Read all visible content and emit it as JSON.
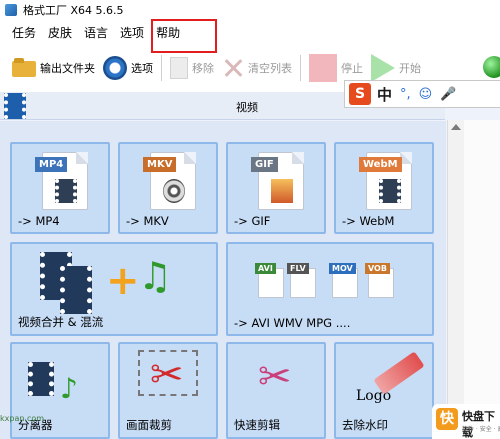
{
  "window": {
    "title": "格式工厂 X64 5.6.5"
  },
  "menu": {
    "items": [
      "任务",
      "皮肤",
      "语言",
      "选项",
      "帮助"
    ]
  },
  "toolbar": {
    "output_folder": "输出文件夹",
    "options": "选项",
    "remove": "移除",
    "clear_list": "清空列表",
    "stop": "停止",
    "start": "开始"
  },
  "ime": {
    "logo": "S",
    "lang": "中",
    "punct": "°,"
  },
  "section": {
    "title": "视频"
  },
  "tiles": [
    {
      "label": "-> MP4",
      "tag": "MP4",
      "tag_color": "#3d73b8"
    },
    {
      "label": "-> MKV",
      "tag": "MKV",
      "tag_color": "#c86e2a"
    },
    {
      "label": "-> GIF",
      "tag": "GIF",
      "tag_color": "#6b7685"
    },
    {
      "label": "-> WebM",
      "tag": "WebM",
      "tag_color": "#e07a3a"
    },
    {
      "label": "视频合并 & 混流"
    },
    {
      "label": "-> AVI WMV MPG ....",
      "formats": [
        "AVI",
        "FLV",
        "MOV",
        "VOB"
      ]
    },
    {
      "label": "分离器"
    },
    {
      "label": "画面裁剪"
    },
    {
      "label": "快速剪辑"
    },
    {
      "label": "去除水印",
      "art_text": "Logo"
    }
  ],
  "watermark": {
    "left": "kxpan.com",
    "brand": "快盘下载",
    "brand_logo": "快",
    "sub": "软件 · 安全 · 高速"
  }
}
